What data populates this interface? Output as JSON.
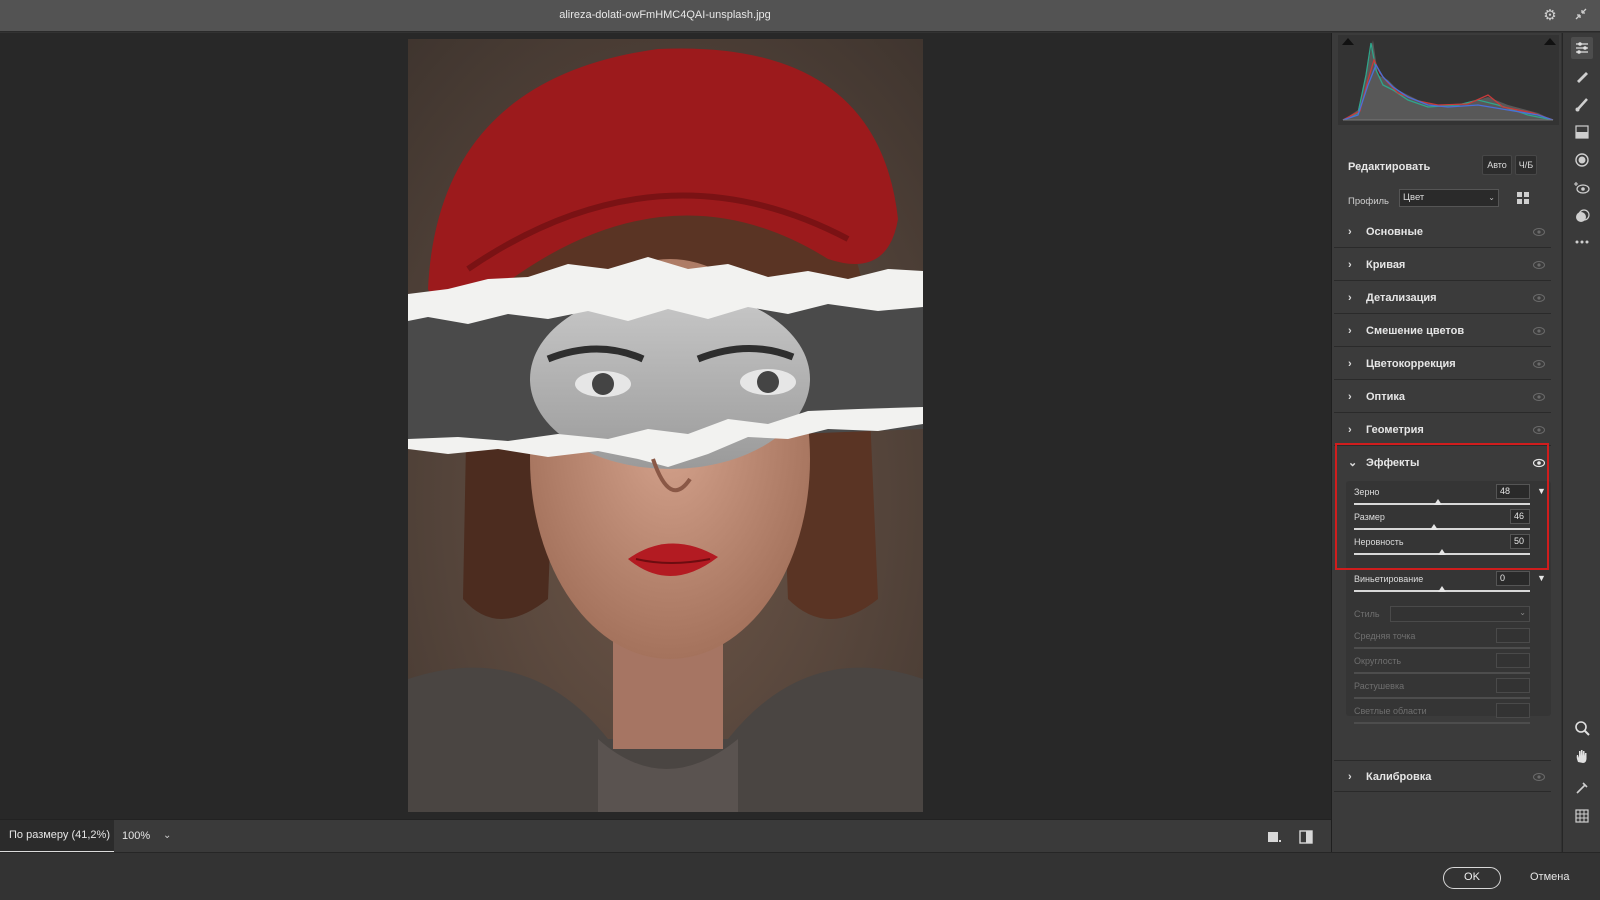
{
  "window": {
    "title": "alireza-dolati-owFmHMC4QAI-unsplash.jpg"
  },
  "statusbar": {
    "zoom_fit_label": "По размеру (41,2%)",
    "zoom_percent": "100%"
  },
  "footer": {
    "ok_label": "OK",
    "cancel_label": "Отмена"
  },
  "panel": {
    "edit_label": "Редактировать",
    "auto_label": "Авто",
    "bw_label": "Ч/Б",
    "profile_label": "Профиль",
    "profile_value": "Цвет",
    "sections": [
      {
        "label": "Основные",
        "expanded": false
      },
      {
        "label": "Кривая",
        "expanded": false
      },
      {
        "label": "Детализация",
        "expanded": false
      },
      {
        "label": "Смешение цветов",
        "expanded": false
      },
      {
        "label": "Цветокоррекция",
        "expanded": false
      },
      {
        "label": "Оптика",
        "expanded": false
      },
      {
        "label": "Геометрия",
        "expanded": false
      },
      {
        "label": "Эффекты",
        "expanded": true
      },
      {
        "label": "Калибровка",
        "expanded": false
      }
    ],
    "effects": {
      "grain": {
        "label": "Зерно",
        "value": "48"
      },
      "size": {
        "label": "Размер",
        "value": "46"
      },
      "roughness": {
        "label": "Неровность",
        "value": "50"
      },
      "vignette": {
        "label": "Виньетирование",
        "value": "0"
      },
      "style_label": "Стиль",
      "midpoint": {
        "label": "Средняя точка",
        "value": ""
      },
      "roundness": {
        "label": "Округлость",
        "value": ""
      },
      "feather": {
        "label": "Растушевка",
        "value": ""
      },
      "highlights": {
        "label": "Светлые области",
        "value": ""
      }
    }
  },
  "colors": {
    "accent_highlight": "#d01d1d",
    "background": "#282828"
  }
}
